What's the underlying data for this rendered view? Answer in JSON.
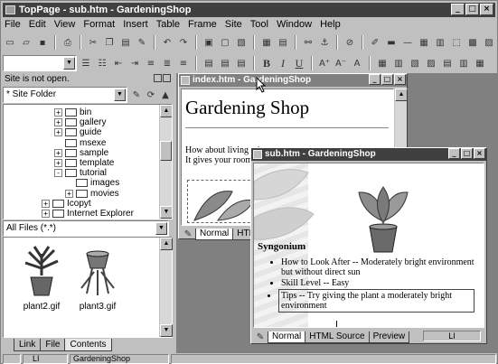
{
  "app": {
    "title": "TopPage - sub.htm - GardeningShop"
  },
  "menu": [
    "File",
    "Edit",
    "View",
    "Format",
    "Insert",
    "Table",
    "Frame",
    "Site",
    "Tool",
    "Window",
    "Help"
  ],
  "left_panel": {
    "status": "Site is not open.",
    "site_combo": "* Site Folder",
    "tree": [
      {
        "label": "bin",
        "level": 0,
        "expander": "+"
      },
      {
        "label": "gallery",
        "level": 0,
        "expander": "+"
      },
      {
        "label": "guide",
        "level": 0,
        "expander": "+"
      },
      {
        "label": "msexe",
        "level": 0,
        "expander": ""
      },
      {
        "label": "sample",
        "level": 0,
        "expander": "+"
      },
      {
        "label": "template",
        "level": 0,
        "expander": "+"
      },
      {
        "label": "tutorial",
        "level": 0,
        "expander": "-"
      },
      {
        "label": "images",
        "level": 1,
        "expander": ""
      },
      {
        "label": "movies",
        "level": 1,
        "expander": "+"
      },
      {
        "label": "Icopyt",
        "level": -1,
        "expander": "+"
      },
      {
        "label": "Internet Explorer",
        "level": -1,
        "expander": "+"
      }
    ],
    "file_combo": "All Files (*.*)",
    "files": [
      {
        "name": "plant2.gif"
      },
      {
        "name": "plant3.gif"
      }
    ],
    "tabs": [
      "Link",
      "File",
      "Contents"
    ],
    "active_tab": "Contents"
  },
  "index_window": {
    "title": "index.htm - GardeningShop",
    "heading": "Gardening Shop",
    "text_line1": "How about living wi",
    "text_line2": "It gives your room a",
    "view_tabs": [
      "Normal",
      "HTML S"
    ]
  },
  "sub_window": {
    "title": "sub.htm - GardeningShop",
    "plant_name": "Syngonium",
    "bullets": [
      "How to Look After -- Moderately bright environment but without direct sun",
      "Skill Level -- Easy",
      "Tips -- Try giving the plant a moderately bright environment"
    ],
    "view_tabs": [
      "Normal",
      "HTML Source",
      "Preview"
    ],
    "status_right": "LI"
  },
  "status_bar": {
    "left": "LI",
    "site": "GardeningShop"
  },
  "colors": {
    "titlebar": "#404040",
    "inactive_title": "#808080",
    "face": "#c0c0c0"
  }
}
